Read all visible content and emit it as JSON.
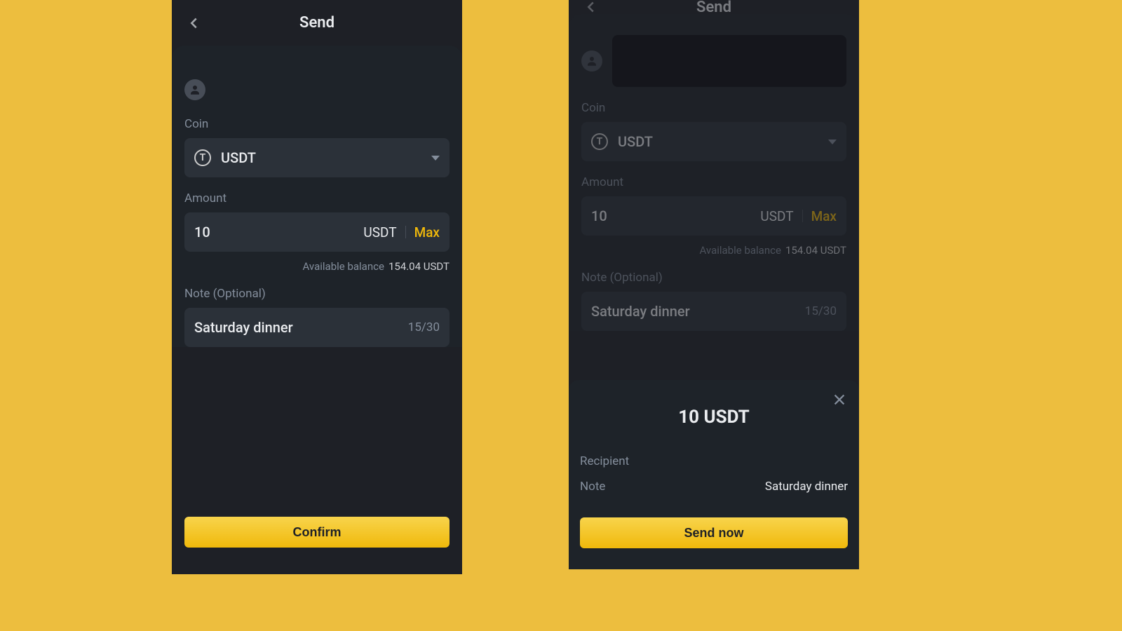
{
  "left": {
    "title": "Send",
    "labels": {
      "coin": "Coin",
      "amount": "Amount",
      "note": "Note (Optional)"
    },
    "coin": {
      "symbol": "USDT"
    },
    "amount": {
      "value": "10",
      "unit": "USDT",
      "max": "Max"
    },
    "balance": {
      "label": "Available balance",
      "value": "154.04 USDT"
    },
    "note": {
      "text": "Saturday dinner",
      "count": "15/30"
    },
    "confirm": "Confirm"
  },
  "right": {
    "title": "Send",
    "labels": {
      "coin": "Coin",
      "amount": "Amount",
      "note": "Note (Optional)"
    },
    "coin": {
      "symbol": "USDT"
    },
    "amount": {
      "value": "10",
      "unit": "USDT",
      "max": "Max"
    },
    "balance": {
      "label": "Available balance",
      "value": "154.04 USDT"
    },
    "note": {
      "text": "Saturday dinner",
      "count": "15/30"
    },
    "sheet": {
      "title": "10 USDT",
      "recipient_label": "Recipient",
      "note_label": "Note",
      "note_value": "Saturday dinner",
      "send_now": "Send now"
    }
  }
}
